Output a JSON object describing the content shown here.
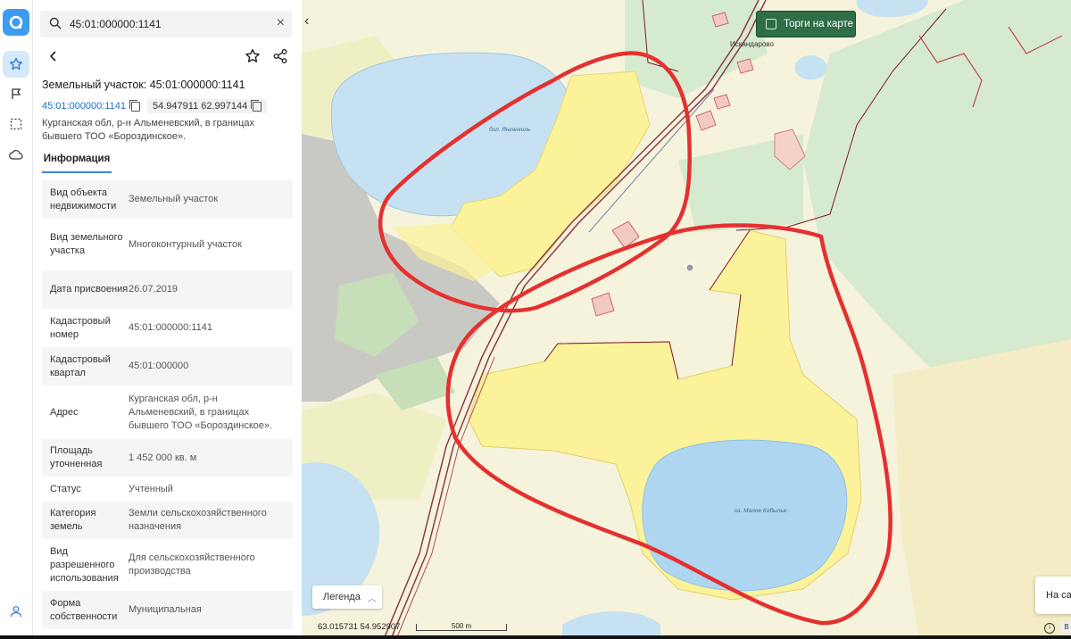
{
  "search": {
    "query": "45:01:000000:1141"
  },
  "title": "Земельный участок: 45:01:000000:1141",
  "cadastral_link": "45:01:000000:1141",
  "coordinates": "54.947911 62.997144",
  "address": "Курганская обл, р-н Альменевский, в границах бывшего ТОО «Бороздинское».",
  "tab": "Информация",
  "rows": [
    {
      "key": "Вид объекта недвижимости",
      "value": "Земельный участок"
    },
    {
      "key": "Вид земельного участка",
      "value": "Многоконтурный участок"
    },
    {
      "key": "Дата присвоения",
      "value": "26.07.2019"
    },
    {
      "key": "Кадастровый номер",
      "value": "45:01:000000:1141"
    },
    {
      "key": "Кадастровый квартал",
      "value": "45:01:000000"
    },
    {
      "key": "Адрес",
      "value": "Курганская обл, р-н Альменевский, в границах бывшего ТОО «Бороздинское»."
    },
    {
      "key": "Площадь уточненная",
      "value": "1 452 000 кв. м"
    },
    {
      "key": "Статус",
      "value": "Учтенный"
    },
    {
      "key": "Категория земель",
      "value": "Земли сельскохозяйственного назначения"
    },
    {
      "key": "Вид разрешенного использования",
      "value": "Для сельскохозяйственного производства"
    },
    {
      "key": "Форма собственности",
      "value": "Муниципальная"
    }
  ],
  "map": {
    "torgi_label": "Торги на карте",
    "village_label": "Искандарово",
    "lake1_label": "бол. Янганколь",
    "lake2_label": "оз. Малое Кобылье",
    "legend_label": "Легенда",
    "coord_readout": "63.015731  54.952907",
    "scale_label": "500 m",
    "partial_card_label": "На са",
    "b_label": "B"
  },
  "colors": {
    "accent": "#3d9bf0",
    "link": "#1f6fc7",
    "parcel_fill": "#fbf29a",
    "annotation_red": "#e53030",
    "torgi_button": "#2e6e48",
    "lake": "#c6e2f2",
    "forest": "#d6ead0"
  }
}
